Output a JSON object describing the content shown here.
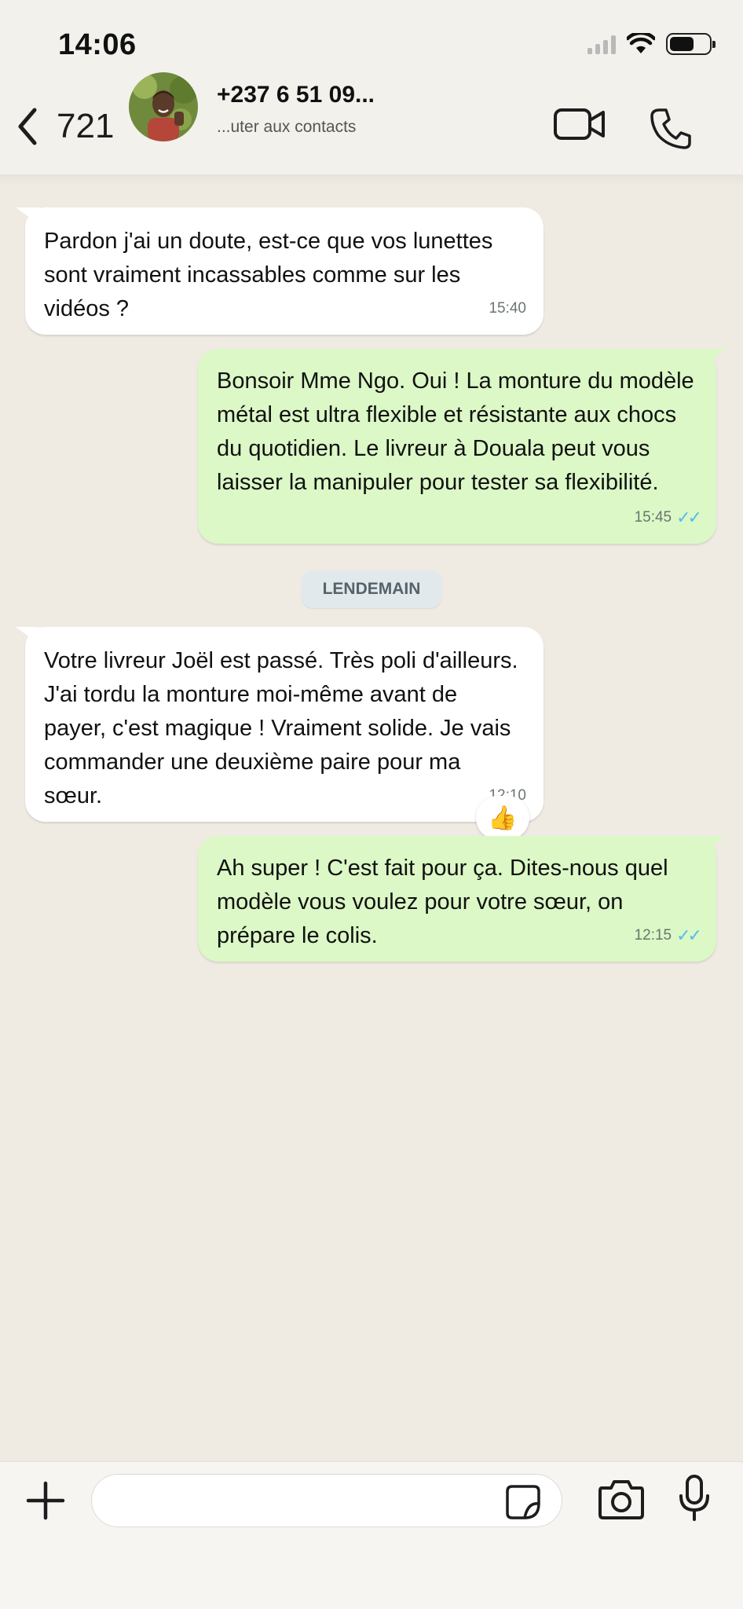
{
  "status_bar": {
    "time": "14:06"
  },
  "header": {
    "back_count": "721",
    "contact_name": "+237 6 51 09...",
    "contact_subtitle": "...uter aux contacts",
    "icons": [
      "back-chevron-icon",
      "video-call-icon",
      "phone-icon"
    ]
  },
  "messages": [
    {
      "direction": "incoming",
      "text": "Pardon j'ai un doute, est-ce que vos lunettes sont vraiment incassables comme sur les vidéos ?",
      "time": "15:40"
    },
    {
      "direction": "outgoing",
      "text": "Bonsoir Mme Ngo. Oui ! La monture du modèle métal est ultra flexible et résistante aux chocs du quotidien. Le livreur à Douala peut vous laisser la manipuler pour tester sa flexibilité.",
      "time": "15:45",
      "status": "✓✓"
    },
    {
      "direction": "incoming",
      "text": "Votre livreur Joël est passé. Très poli d'ailleurs. J'ai tordu la monture moi-même avant de payer, c'est magique ! Vraiment solide. Je vais commander une deuxième paire pour ma sœur.",
      "time": "12:10",
      "reaction": "👍"
    },
    {
      "direction": "outgoing",
      "text": "Ah super ! C'est fait pour ça. Dites-nous quel modèle vous voulez pour votre sœur, on prépare le colis.",
      "time": "12:15",
      "status": "✓✓"
    }
  ],
  "day_separator": "LENDEMAIN",
  "composer": {
    "placeholder": "",
    "icons": [
      "plus-icon",
      "sticker-icon",
      "camera-icon",
      "microphone-icon"
    ]
  },
  "colors": {
    "chat_background": "#efeae2",
    "incoming_bubble": "#ffffff",
    "outgoing_bubble": "#dbf8c6",
    "read_ticks": "#53bdeb"
  }
}
